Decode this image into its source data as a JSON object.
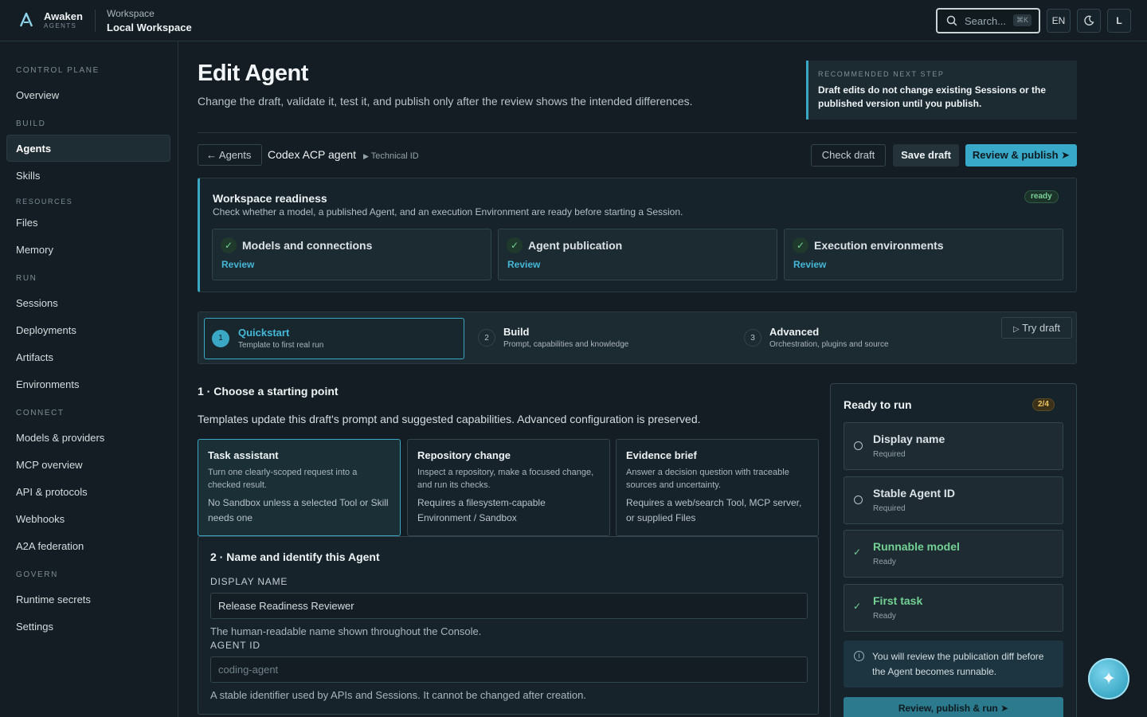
{
  "brand": {
    "name": "Awaken",
    "sub": "AGENTS"
  },
  "workspace": {
    "label": "Workspace",
    "name": "Local Workspace"
  },
  "topbar": {
    "search_text": "Search...",
    "search_shortcut": "⌘K",
    "lang": "EN",
    "theme_icon": "moon-icon",
    "user_initial": "L"
  },
  "sidebar": {
    "sections": {
      "control_plane": "CONTROL PLANE",
      "build": "BUILD",
      "resources": "RESOURCES",
      "run": "RUN",
      "connect": "CONNECT",
      "govern": "GOVERN"
    },
    "items": {
      "overview": "Overview",
      "agents": "Agents",
      "skills": "Skills",
      "files": "Files",
      "memory": "Memory",
      "sessions": "Sessions",
      "deployments": "Deployments",
      "artifacts": "Artifacts",
      "environments": "Environments",
      "models": "Models & providers",
      "mcp": "MCP overview",
      "api": "API & protocols",
      "webhooks": "Webhooks",
      "a2a": "A2A federation",
      "secrets": "Runtime secrets",
      "settings": "Settings"
    },
    "active": "agents"
  },
  "page": {
    "title": "Edit Agent",
    "description": "Change the draft, validate it, test it, and publish only after the review shows the intended differences.",
    "recommended_label": "RECOMMENDED NEXT STEP",
    "recommended_text": "Draft edits do not change existing Sessions or the published version until you publish."
  },
  "toolbar": {
    "back_label": "Agents",
    "agent_name": "Codex ACP agent",
    "technical_id": "Technical ID",
    "check_draft": "Check draft",
    "save_draft": "Save draft",
    "review_publish": "Review & publish"
  },
  "readiness": {
    "title": "Workspace readiness",
    "description": "Check whether a model, a published Agent, and an execution Environment are ready before starting a Session.",
    "status": "ready",
    "cards": [
      {
        "title": "Models and connections",
        "link": "Review"
      },
      {
        "title": "Agent publication",
        "link": "Review"
      },
      {
        "title": "Execution environments",
        "link": "Review"
      }
    ]
  },
  "stepper": {
    "steps": [
      {
        "num": "1",
        "title": "Quickstart",
        "sub": "Template to first real run"
      },
      {
        "num": "2",
        "title": "Build",
        "sub": "Prompt, capabilities and knowledge"
      },
      {
        "num": "3",
        "title": "Advanced",
        "sub": "Orchestration, plugins and source"
      }
    ],
    "active_step": 1,
    "try_draft": "Try draft"
  },
  "section1": {
    "title": "1 · Choose a starting point",
    "description": "Templates update this draft's prompt and suggested capabilities. Advanced configuration is preserved.",
    "templates": [
      {
        "title": "Task assistant",
        "desc": "Turn one clearly-scoped request into a checked result.",
        "req": "No Sandbox unless a selected Tool or Skill needs one"
      },
      {
        "title": "Repository change",
        "desc": "Inspect a repository, make a focused change, and run its checks.",
        "req": "Requires a filesystem-capable Environment / Sandbox"
      },
      {
        "title": "Evidence brief",
        "desc": "Answer a decision question with traceable sources and uncertainty.",
        "req": "Requires a web/search Tool, MCP server, or supplied Files"
      }
    ],
    "selected_template": 0
  },
  "section2": {
    "title": "2 · Name and identify this Agent",
    "display_name_label": "DISPLAY NAME",
    "display_name_value": "Release Readiness Reviewer",
    "display_name_help": "The human-readable name shown throughout the Console.",
    "agent_id_label": "AGENT ID",
    "agent_id_placeholder": "coding-agent",
    "agent_id_help": "A stable identifier used by APIs and Sessions. It cannot be changed after creation."
  },
  "ready_to_run": {
    "title": "Ready to run",
    "progress": "2/4",
    "items": [
      {
        "title": "Display name",
        "status": "Required",
        "done": false
      },
      {
        "title": "Stable Agent ID",
        "status": "Required",
        "done": false
      },
      {
        "title": "Runnable model",
        "status": "Ready",
        "done": true
      },
      {
        "title": "First task",
        "status": "Ready",
        "done": true
      }
    ],
    "info": "You will review the publication diff before the Agent becomes runnable.",
    "button": "Review, publish & run"
  },
  "colors": {
    "accent": "#38a9c9",
    "background": "#131d23",
    "success": "#73d193",
    "warning": "#f0c563"
  }
}
